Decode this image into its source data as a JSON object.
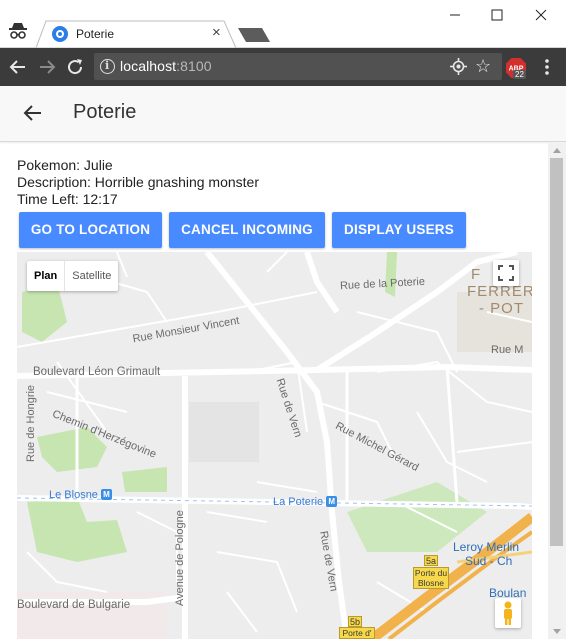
{
  "browser": {
    "tab_title": "Poterie",
    "tab_close": "×",
    "url_host": "localhost",
    "url_port": ":8100",
    "extension_count": "22",
    "extension_name": "ABP"
  },
  "app": {
    "title": "Poterie"
  },
  "details": {
    "pokemon": "Pokemon: Julie",
    "description": "Description: Horrible gnashing monster",
    "time_left": "Time Left: 12:17"
  },
  "actions": {
    "go_to_location": "GO TO LOCATION",
    "cancel_incoming": "CANCEL INCOMING",
    "display_users": "DISPLAY USERS"
  },
  "map": {
    "type_plan": "Plan",
    "type_satellite": "Satellite",
    "metro_symbol": "M",
    "labels": {
      "rue_de_la_poterie": "Rue de la Poterie",
      "rue_monsieur_vincent": "Rue Monsieur Vincent",
      "boulevard_leon_grimault": "Boulevard Léon Grimault",
      "rue_de_vern_1": "Rue de Vern",
      "rue_de_hongrie": "Rue de Hongrie",
      "chemin_herzegovine": "Chemin d'Herzégovine",
      "rue_michel_gerard": "Rue Michel Gérard",
      "le_blosne": "Le Blosne",
      "la_poterie": "La Poterie",
      "avenue_de_pologne": "Avenue de Pologne",
      "rue_de_vern_2": "Rue de Vern",
      "boulevard_de_bulgarie": "Boulevard de Bulgarie",
      "leroy_merlin": "Leroy Merlin",
      "sud_ch": "Sud - Ch",
      "boulan": "Boulan",
      "ferrer_1": "F",
      "ferrer_2": "FERRER",
      "ferrer_3": "- POT",
      "rue_m": "Rue M",
      "exit_5a": "5a",
      "exit_5a_name": "Porte du Blosne",
      "exit_5b": "5b",
      "exit_5b_name": "Porte d'"
    }
  },
  "colors": {
    "primary_button": "#488aff",
    "metro": "#3a8ee6",
    "map_background": "#ededed",
    "park": "#c6e5b0",
    "exit_badge": "#f6d84a"
  }
}
